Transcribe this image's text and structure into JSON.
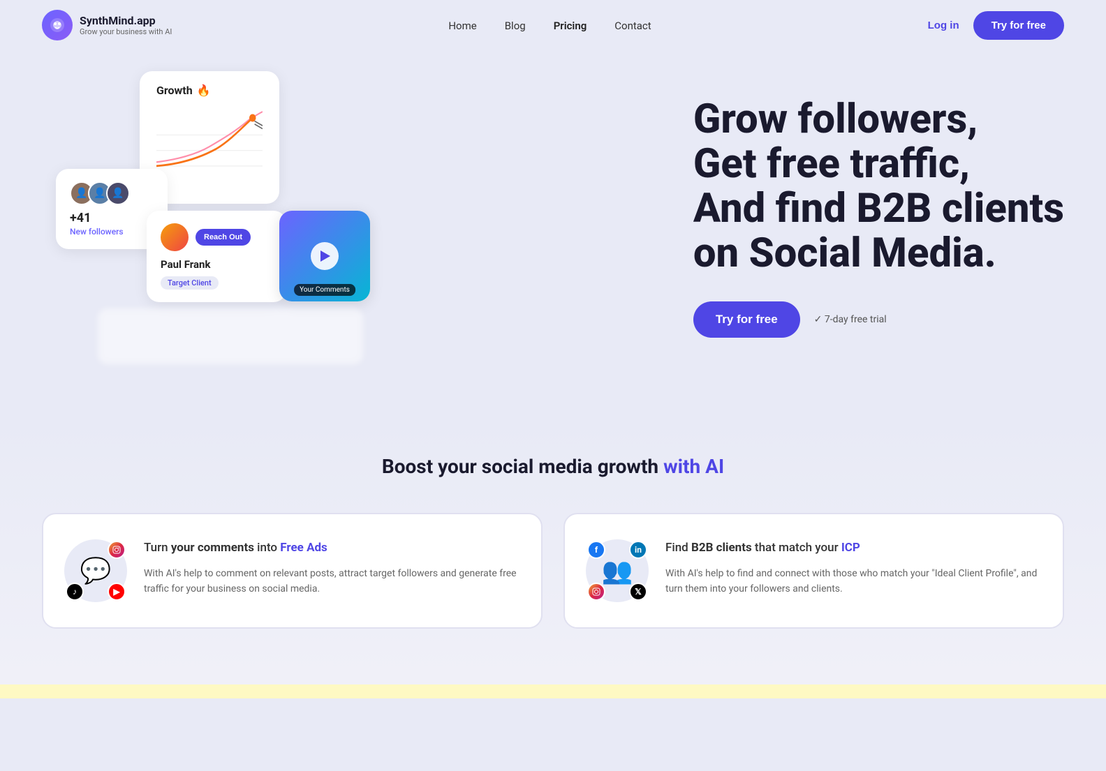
{
  "brand": {
    "name": "SynthMind.app",
    "tagline": "Grow your business with AI",
    "logo_icon": "🧠"
  },
  "nav": {
    "links": [
      {
        "label": "Home",
        "active": false
      },
      {
        "label": "Blog",
        "active": false
      },
      {
        "label": "Pricing",
        "active": true
      },
      {
        "label": "Contact",
        "active": false
      }
    ],
    "login_label": "Log in",
    "try_label": "Try for free"
  },
  "hero": {
    "headline_line1": "Grow followers,",
    "headline_line2": "Get free traffic,",
    "headline_line3": "And find B2B clients",
    "headline_line4": "on Social Media.",
    "cta_label": "Try for free",
    "trial_text": "✓ 7-day free trial",
    "ui_card_growth": {
      "title": "Growth",
      "flame": "🔥"
    },
    "ui_card_followers": {
      "count": "+41",
      "label": "New followers"
    },
    "ui_card_target": {
      "name": "Paul Frank",
      "badge": "Target Client",
      "reach_out": "Reach Out"
    },
    "ui_card_video": {
      "label": "Your Comments"
    }
  },
  "boost": {
    "title_prefix": "Boost your social media growth ",
    "title_accent": "with AI",
    "cards": [
      {
        "title_prefix": "Turn ",
        "title_bold": "your comments",
        "title_mid": " into ",
        "title_accent": "Free Ads",
        "description": "With AI's help to comment on relevant posts, attract target followers and generate free traffic for your business on social media.",
        "icon": "💬",
        "social_icons": [
          "ig",
          "yt",
          "tiktok"
        ]
      },
      {
        "title_prefix": "Find ",
        "title_bold": "B2B clients",
        "title_mid": " that match your ",
        "title_accent": "ICP",
        "description": "With AI's help to find and connect with those who match your \"Ideal Client Profile\", and turn them into your followers and clients.",
        "icon": "👥",
        "social_icons": [
          "fb",
          "li",
          "x",
          "ig2"
        ]
      }
    ]
  }
}
